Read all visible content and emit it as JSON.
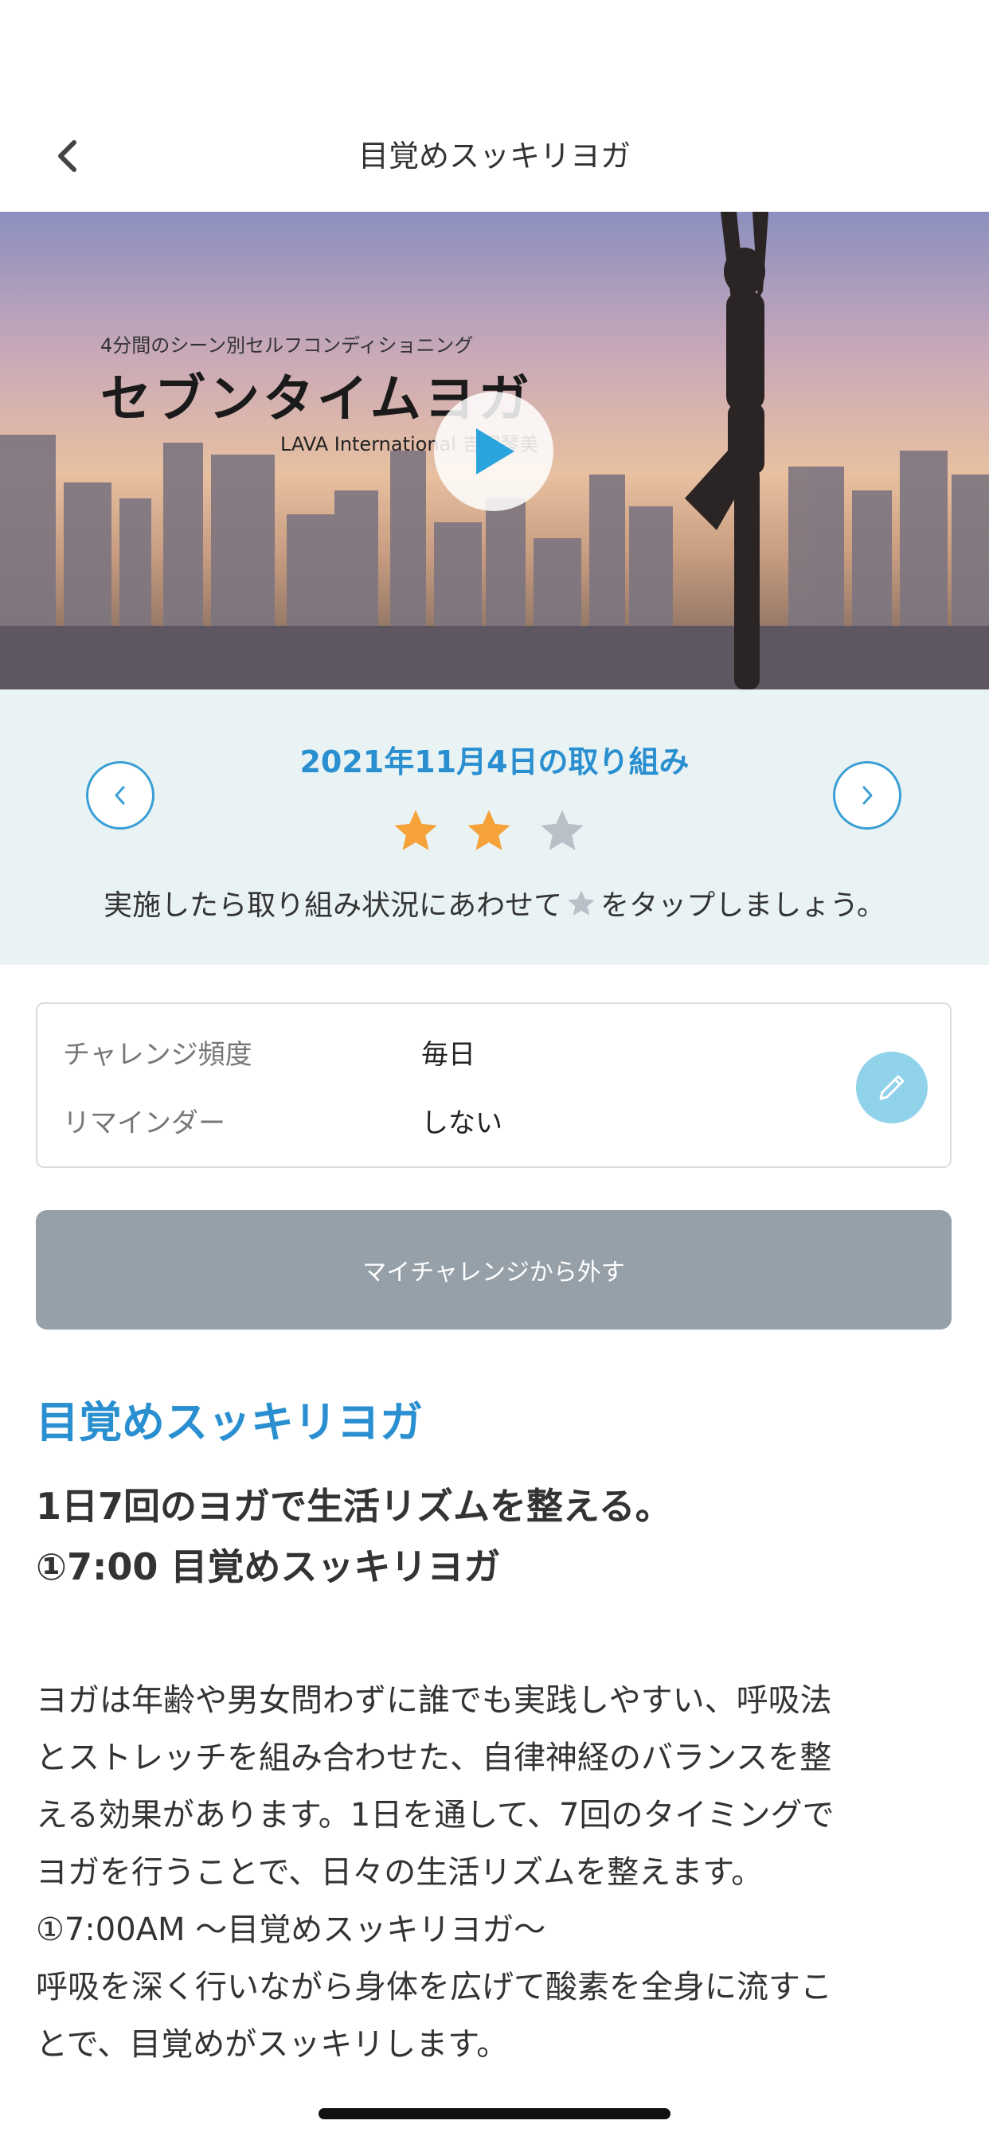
{
  "header": {
    "title": "目覚めスッキリヨガ",
    "back_icon": "chevron-left-icon"
  },
  "hero": {
    "subtitle": "4分間のシーン別セルフコンディショニング",
    "title": "セブンタイムヨガ",
    "credit": "LAVA International 吉田琴美",
    "play_icon": "play-icon"
  },
  "progress": {
    "date_label": "2021年11月4日の取り組み",
    "prev_icon": "chevron-left-icon",
    "next_icon": "chevron-right-icon",
    "rating": 2,
    "rating_max": 3,
    "hint_before": "実施したら取り組み状況にあわせて",
    "hint_after": "をタップしましょう。",
    "colors": {
      "star_on": "#f5a23a",
      "star_off": "#b9c0c8",
      "accent": "#2a8fd0"
    }
  },
  "settings": {
    "frequency_label": "チャレンジ頻度",
    "frequency_value": "毎日",
    "reminder_label": "リマインダー",
    "reminder_value": "しない",
    "edit_icon": "pencil-icon"
  },
  "remove_button_label": "マイチャレンジから外す",
  "content": {
    "title": "目覚めスッキリヨガ",
    "subheading_lines": [
      "1日7回のヨガで生活リズムを整える。",
      "①7:00 目覚めスッキリヨガ"
    ],
    "body_lines": [
      "ヨガは年齢や男女問わずに誰でも実践しやすい、呼吸法",
      "とストレッチを組み合わせた、自律神経のバランスを整",
      "える効果があります。1日を通して、7回のタイミングで",
      "ヨガを行うことで、日々の生活リズムを整えます。",
      "①7:00AM 〜目覚めスッキリヨガ〜",
      "呼吸を深く行いながら身体を広げて酸素を全身に流すこ",
      "とで、目覚めがスッキリします。"
    ]
  }
}
